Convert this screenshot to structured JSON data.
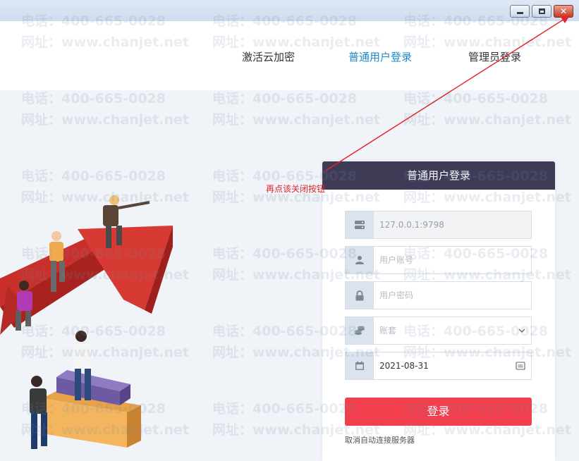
{
  "nav": {
    "items": [
      {
        "label": "激活云加密",
        "active": false
      },
      {
        "label": "普通用户登录",
        "active": true
      },
      {
        "label": "管理员登录",
        "active": false
      }
    ]
  },
  "watermark": {
    "line1": "电话：400-665-0028",
    "line2": "网址：www.chanjet.net"
  },
  "annotation": {
    "text": "再点该关闭按钮",
    "color": "#e0262b"
  },
  "login": {
    "title": "普通用户登录",
    "server_value": "127.0.0.1:9798",
    "account_placeholder": "用户账号",
    "password_placeholder": "用户密码",
    "book_placeholder": "账套",
    "date_value": "2021-08-31",
    "submit_label": "登录",
    "cancel_link": "取消自动连接服务器"
  },
  "colors": {
    "accent": "#1d8acb",
    "panel_header": "#3e3b57",
    "button": "#f13f4d"
  },
  "icons": {
    "server": "server-icon",
    "user": "user-icon",
    "lock": "lock-icon",
    "book": "coins-icon",
    "calendar": "calendar-icon"
  }
}
